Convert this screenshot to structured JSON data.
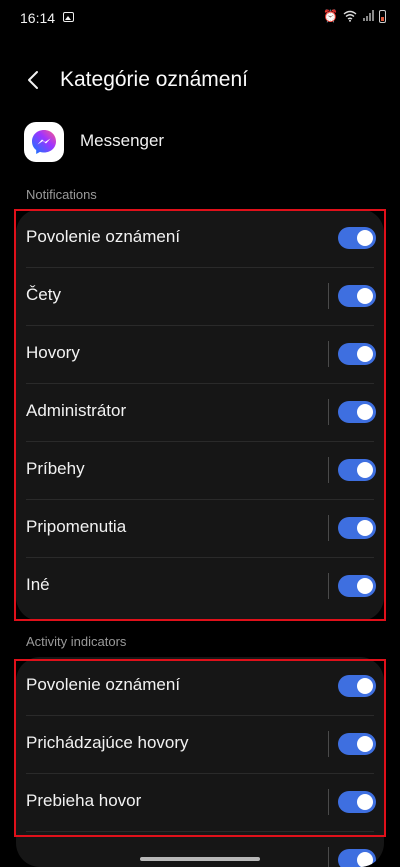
{
  "status_bar": {
    "time": "16:14"
  },
  "header": {
    "title": "Kategórie oznámení"
  },
  "app": {
    "name": "Messenger"
  },
  "sections": {
    "notifications": {
      "label": "Notifications",
      "rows": [
        {
          "label": "Povolenie oznámení",
          "enabled": true
        },
        {
          "label": "Čety",
          "enabled": true
        },
        {
          "label": "Hovory",
          "enabled": true
        },
        {
          "label": "Administrátor",
          "enabled": true
        },
        {
          "label": "Príbehy",
          "enabled": true
        },
        {
          "label": "Pripomenutia",
          "enabled": true
        },
        {
          "label": "Iné",
          "enabled": true
        }
      ]
    },
    "activity": {
      "label": "Activity indicators",
      "rows": [
        {
          "label": "Povolenie oznámení",
          "enabled": true
        },
        {
          "label": "Prichádzajúce hovory",
          "enabled": true
        },
        {
          "label": "Prebieha hovor",
          "enabled": true
        }
      ]
    }
  },
  "colors": {
    "toggle_on": "#3e6fe0",
    "highlight_border": "#e0101a",
    "card_bg": "#161616"
  }
}
